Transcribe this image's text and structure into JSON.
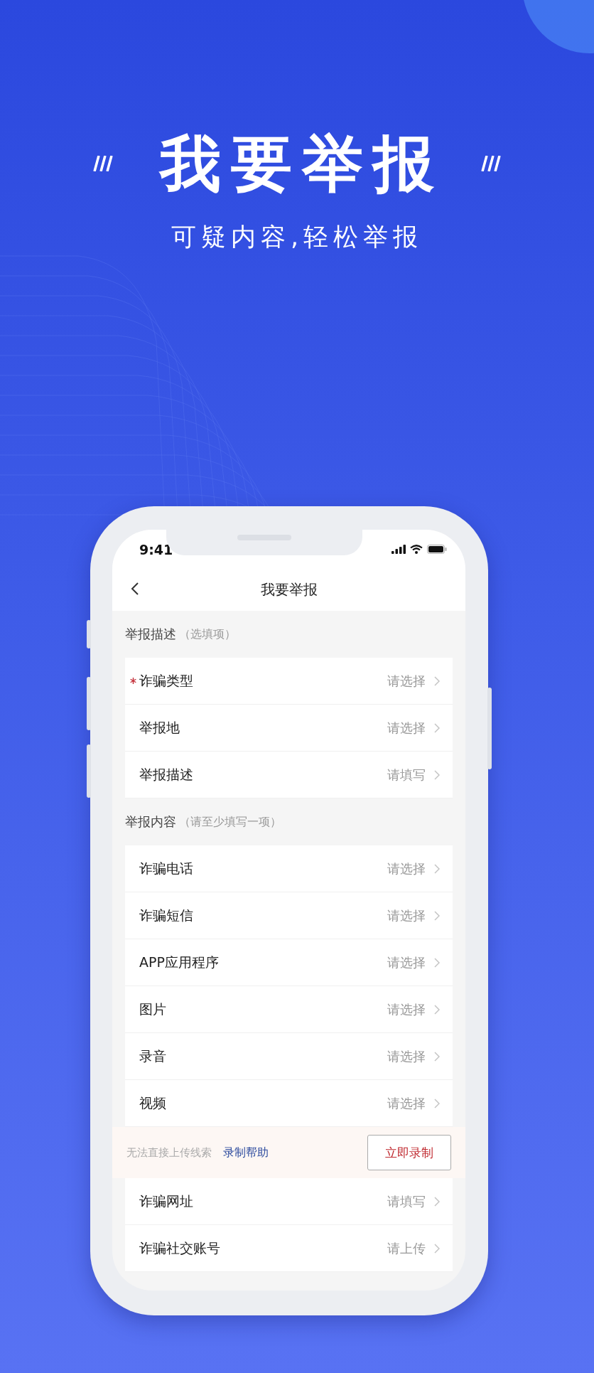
{
  "headline": "我要举报",
  "subtitle": "可疑内容,轻松举报",
  "status_bar": {
    "time": "9:41"
  },
  "nav": {
    "title": "我要举报"
  },
  "sections": [
    {
      "title": "举报描述",
      "note": "（选填项）",
      "rows": [
        {
          "kind": "field",
          "label": "诈骗类型",
          "required": true,
          "value": "请选择"
        },
        {
          "kind": "field",
          "label": "举报地",
          "required": false,
          "value": "请选择"
        },
        {
          "kind": "field",
          "label": "举报描述",
          "required": false,
          "value": "请填写"
        }
      ]
    },
    {
      "title": "举报内容",
      "note": "（请至少填写一项）",
      "rows": [
        {
          "kind": "field",
          "label": "诈骗电话",
          "required": false,
          "value": "请选择"
        },
        {
          "kind": "field",
          "label": "诈骗短信",
          "required": false,
          "value": "请选择"
        },
        {
          "kind": "field",
          "label": "APP应用程序",
          "required": false,
          "value": "请选择"
        },
        {
          "kind": "field",
          "label": "图片",
          "required": false,
          "value": "请选择"
        },
        {
          "kind": "field",
          "label": "录音",
          "required": false,
          "value": "请选择"
        },
        {
          "kind": "field",
          "label": "视频",
          "required": false,
          "value": "请选择"
        },
        {
          "kind": "record",
          "hint": "无法直接上传线索",
          "link": "录制帮助",
          "button": "立即录制"
        },
        {
          "kind": "field",
          "label": "诈骗网址",
          "required": false,
          "value": "请填写"
        },
        {
          "kind": "field",
          "label": "诈骗社交账号",
          "required": false,
          "value": "请上传"
        }
      ]
    }
  ]
}
